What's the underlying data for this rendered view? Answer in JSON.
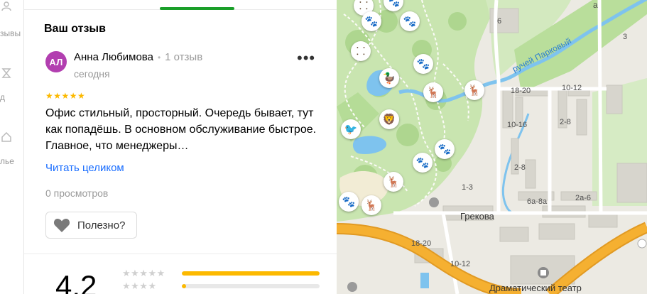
{
  "rail": {
    "items": [
      {
        "label": "зывы",
        "icon": "person-icon"
      },
      {
        "label": "д",
        "icon": "hourglass-icon"
      },
      {
        "label": "лье",
        "icon": "house-icon"
      }
    ]
  },
  "panel": {
    "heading": "Ваш отзыв",
    "review": {
      "avatar_initials": "АЛ",
      "avatar_color": "#b23fb0",
      "author": "Анна Любимова",
      "author_reviews": "1 отзыв",
      "date": "сегодня",
      "stars": "★★★★★",
      "text": "Офис стильный, просторный. Очередь бывает, тут как попадёшь. В основном обслуживание быстрое. Главное, что менеджеры…",
      "read_more": "Читать целиком",
      "views": "0 просмотров",
      "helpful_label": "Полезно?"
    },
    "rating": {
      "value": "4,2",
      "rows": [
        {
          "stars": "★★★★★",
          "fraction": 1.0
        },
        {
          "stars": "★★★★",
          "fraction": 0.03
        }
      ]
    }
  },
  "map": {
    "stream_label": "ручей Парковый",
    "street_labels": [
      "Грекова",
      "Драматический театр"
    ],
    "house_labels": [
      "6",
      "18-20",
      "10-12",
      "10-16",
      "2-8",
      "2-8",
      "1-3",
      "6а-8а",
      "2а-6",
      "18-20",
      "10-12",
      "3",
      "а"
    ],
    "colors": {
      "park": "#c9e5b0",
      "road": "#f5b031",
      "water": "#7ec3ee",
      "building": "#d7d5cd"
    }
  }
}
